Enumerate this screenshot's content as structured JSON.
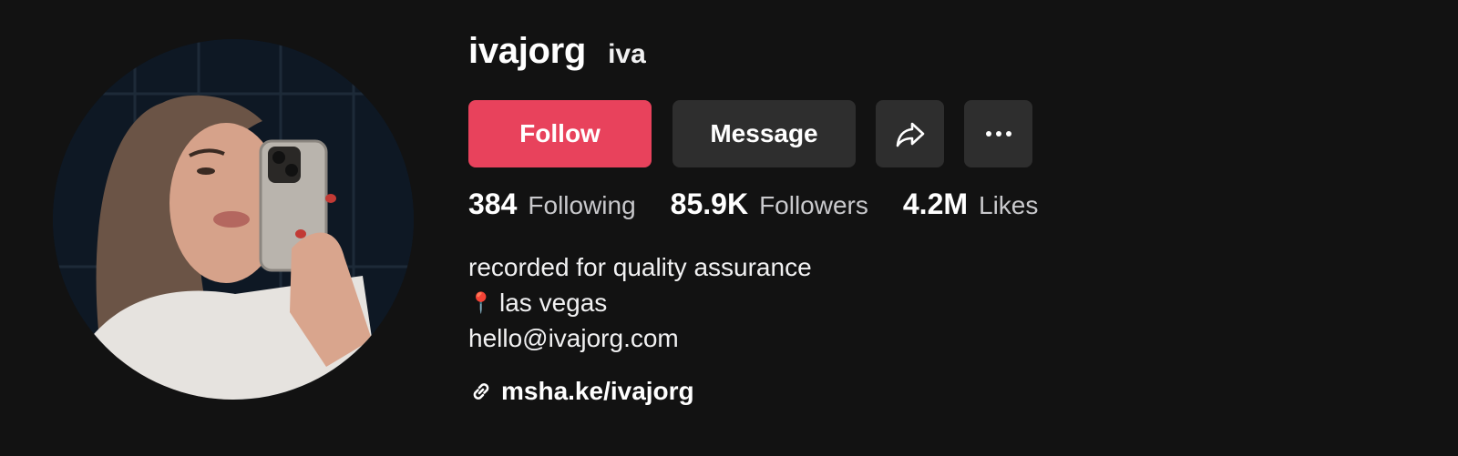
{
  "profile": {
    "username": "ivajorg",
    "nickname": "iva"
  },
  "actions": {
    "follow_label": "Follow",
    "message_label": "Message",
    "share_icon": "share-arrow-icon",
    "more_icon": "more-horizontal-icon"
  },
  "stats": {
    "following_count": "384",
    "following_label": "Following",
    "followers_count": "85.9K",
    "followers_label": "Followers",
    "likes_count": "4.2M",
    "likes_label": "Likes"
  },
  "bio": {
    "line1": "recorded for quality assurance",
    "location_icon": "📍",
    "location": "las vegas",
    "email": "hello@ivajorg.com"
  },
  "link": {
    "icon": "link-icon",
    "text": "msha.ke/ivajorg"
  },
  "colors": {
    "background": "#121212",
    "follow_button": "#e8425c",
    "secondary_button": "#2e2e2e",
    "text_primary": "#ffffff",
    "text_secondary": "#c9c9cc"
  }
}
